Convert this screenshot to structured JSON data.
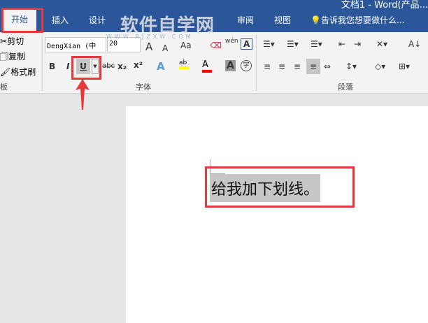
{
  "window": {
    "title": "文档1 - Word(产品..."
  },
  "tabs": [
    {
      "label": "开始"
    },
    {
      "label": "插入"
    },
    {
      "label": "设计"
    },
    {
      "label": "审阅"
    },
    {
      "label": "视图"
    }
  ],
  "tell_me": "告诉我您想要做什么...",
  "watermark": {
    "title": "软件自学网",
    "url": "WWW.RJZXW.COM"
  },
  "clipboard": {
    "cut": "剪切",
    "copy": "复制",
    "format_painter": "格式刷",
    "group": "板"
  },
  "font": {
    "name": "DengXian (中",
    "size": "20",
    "group": "字体",
    "bold": "B",
    "italic": "I",
    "underline": "U",
    "strike": "abc",
    "sub": "x₂",
    "sup": "x²",
    "case": "Aa",
    "phonetic": "wén",
    "char_border": "A",
    "grow": "A",
    "shrink": "A",
    "effects": "A",
    "font_color": "A",
    "shade": "A",
    "enclose": "字"
  },
  "paragraph": {
    "group": "段落"
  },
  "document": {
    "text": "给我加下划线。"
  },
  "colors": {
    "accent": "#2b579a",
    "highlight": "#ffff00",
    "font_color": "#ff0000",
    "annotation": "#e8393a"
  }
}
